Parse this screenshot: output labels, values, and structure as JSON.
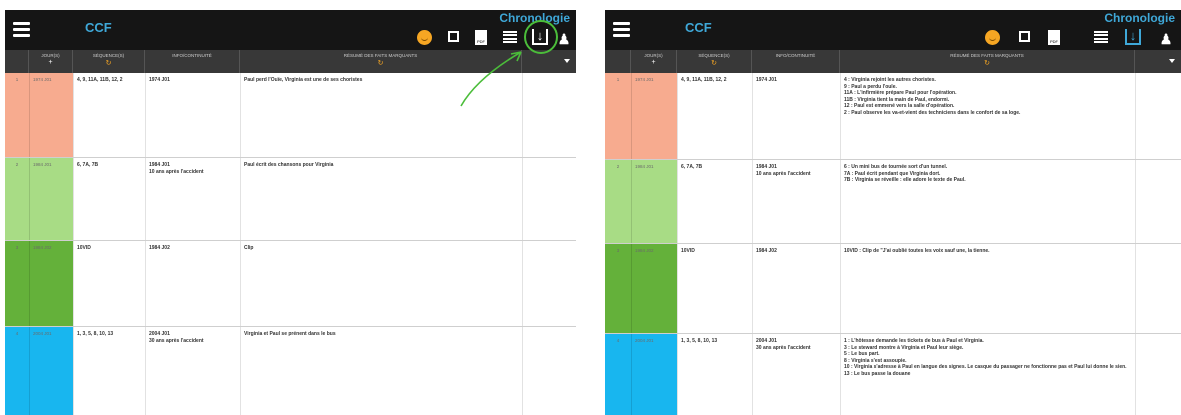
{
  "app": {
    "title": "CCF",
    "view_title": "Chronologie"
  },
  "toolbar": {
    "pdf_label": "PDF"
  },
  "columns": {
    "jours": "JOUR(S)",
    "sequences": "SÉQUENCE(S)",
    "info": "INFO/CONTINUITÉ",
    "resume": "RÉSUMÉ DES FAITS MARQUANTS",
    "jours_sub": "+",
    "sequences_sub": "↻",
    "resume_sub": "↻"
  },
  "colors": {
    "accent": "#3fa8d8",
    "highlight": "#4bbd3a",
    "row1": "#f7ab8f",
    "row2": "#a8dc85",
    "row3": "#64b13a",
    "row4": "#18b6ef"
  },
  "left": {
    "rows": [
      {
        "num": "1",
        "day": "1974 J01",
        "seq": "4, 9, 11A, 11B, 12, 2",
        "info": "1974 J01",
        "resume": "Paul perd l'Ouïe, Virginia est une de ses choristes"
      },
      {
        "num": "2",
        "day": "1984 J01",
        "seq": "6, 7A, 7B",
        "info": "1984 J01\n10 ans après l'accident",
        "resume": "Paul écrit des chansons pour Virginia"
      },
      {
        "num": "3",
        "day": "1984 J02",
        "seq": "10VID",
        "info": "1984 J02",
        "resume": "Clip"
      },
      {
        "num": "4",
        "day": "2004 J01",
        "seq": "1, 3, 5, 8, 10, 13",
        "info": "2004 J01\n30 ans après l'accident",
        "resume": "Virginia et Paul se prénent dans le bus"
      }
    ]
  },
  "right": {
    "rows": [
      {
        "num": "1",
        "day": "1974 J01",
        "seq": "4, 9, 11A, 11B, 12, 2",
        "info": "1974 J01",
        "resume": "4 : Virginia rejoint les autres choristes.\n9 : Paul a perdu l'ouïe.\n11A : L'infirmière prépare Paul pour l'opération.\n11B : Virginia tient la main de Paul, endormi.\n12 : Paul est emmené vers la salle d'opération.\n2 : Paul observe les va-et-vient des techniciens dans le confort de sa loge."
      },
      {
        "num": "2",
        "day": "1984 J01",
        "seq": "6, 7A, 7B",
        "info": "1984 J01\n10 ans après l'accident",
        "resume": "6 : Un mini bus de tournée sort d'un tunnel.\n7A : Paul écrit pendant que Virginia dort.\n7B : Virginia se réveille : elle adore le texte de Paul."
      },
      {
        "num": "3",
        "day": "1984 J02",
        "seq": "10VID",
        "info": "1984 J02",
        "resume": "10VID : Clip de \"J'ai oublié toutes les voix sauf une, la tienne."
      },
      {
        "num": "4",
        "day": "2004 J01",
        "seq": "1, 3, 5, 8, 10, 13",
        "info": "2004 J01\n30 ans après l'accident",
        "resume": "1 : L'hôtesse demande les tickets de bus à Paul et Virginia.\n3 : Le steward montre à Virginia et Paul leur siège.\n5 : Le bus part.\n8 : Virginia s'est assoupie.\n10 : Virginia s'adresse à Paul en langue des signes. Le casque du passager ne fonctionne pas et Paul lui donne le sien.\n13 : Le bus passe la douane"
      }
    ]
  }
}
